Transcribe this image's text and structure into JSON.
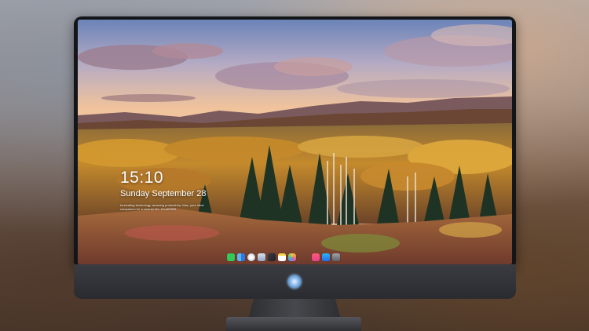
{
  "lockscreen": {
    "time": "15:10",
    "date": "Sunday September 28",
    "note": "Innovating technology, amazing productivity. Mac, your ideal companion for a smarter life. ZouIA0005"
  },
  "dock": {
    "apps": [
      {
        "name": "messages-icon",
        "color": "#34c759"
      },
      {
        "name": "finder-icon",
        "color": "#2b7be4"
      },
      {
        "name": "safari-icon",
        "color": "#e8e8ee"
      },
      {
        "name": "preview-icon",
        "color": "#9fb0c8"
      },
      {
        "name": "final-cut-icon",
        "color": "#2a2a30"
      },
      {
        "name": "notes-icon",
        "color": "#f5d34a"
      },
      {
        "name": "photos-icon",
        "color": "#f08a5d"
      },
      {
        "name": "music-icon",
        "color": "#ef4d8a"
      },
      {
        "name": "app-store-icon",
        "color": "#2f8df6"
      },
      {
        "name": "camera-icon",
        "color": "#7e8189"
      }
    ]
  },
  "colors": {
    "bezel": "#141518",
    "chin": "#2a2b30",
    "logo": "#7fb4e8"
  }
}
